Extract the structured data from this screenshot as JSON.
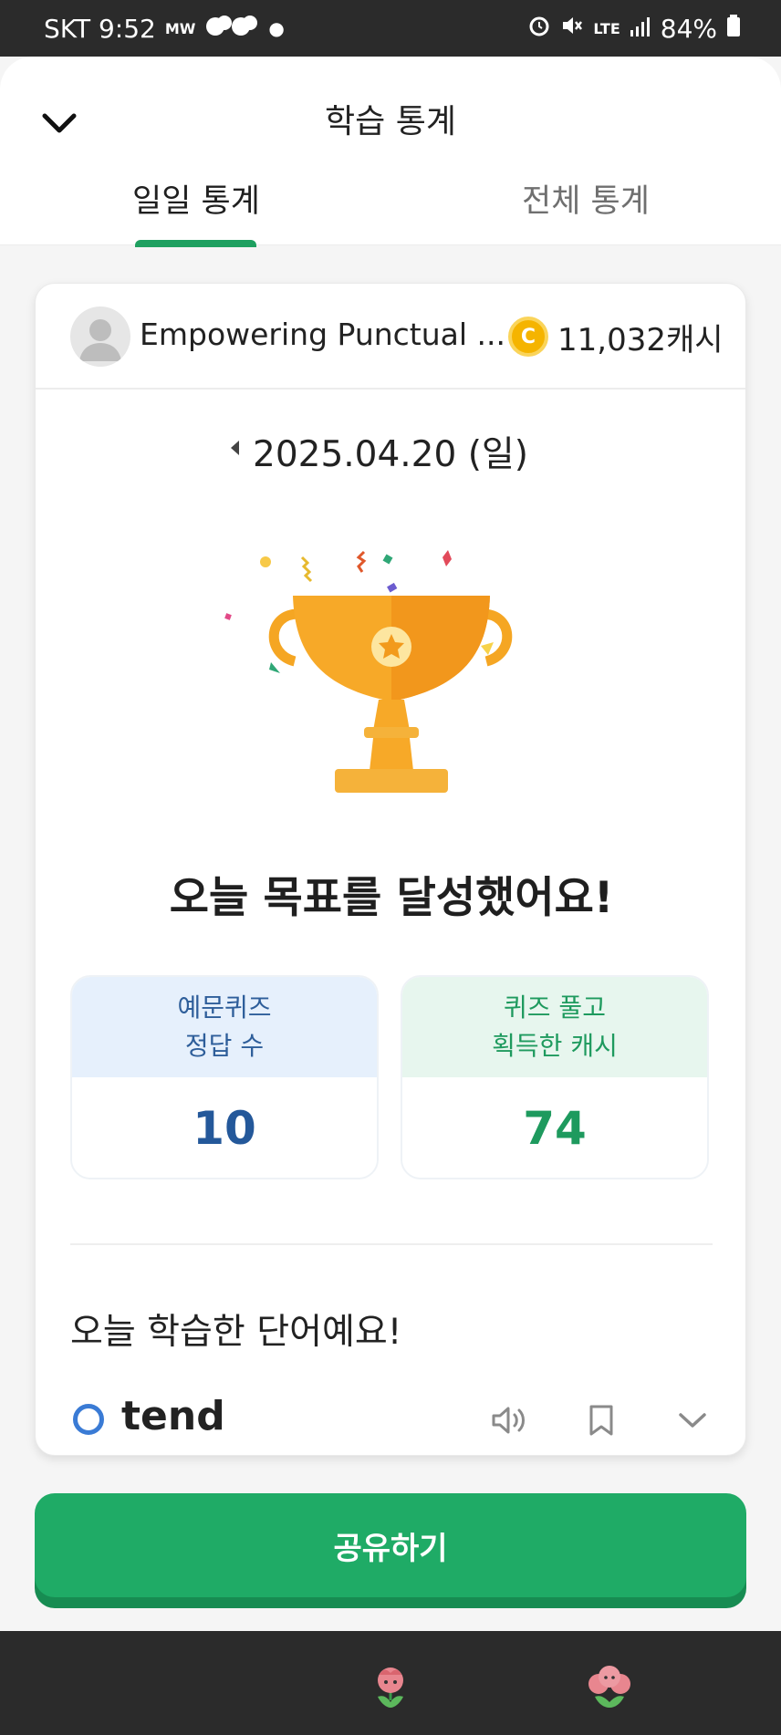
{
  "status_bar": {
    "carrier_time": "SKT 9:52",
    "mw": "MW",
    "network": "LTE",
    "battery": "84%"
  },
  "header": {
    "title": "학습 통계",
    "tabs": [
      {
        "label": "일일 통계",
        "active": true
      },
      {
        "label": "전체 통계",
        "active": false
      }
    ]
  },
  "profile": {
    "name": "Empowering Punctual ...",
    "cash": "11,032캐시"
  },
  "date": {
    "label": "2025.04.20 (일)"
  },
  "achievement": {
    "message": "오늘 목표를 달성했어요!"
  },
  "stats": [
    {
      "label_line1": "예문퀴즈",
      "label_line2": "정답 수",
      "value": "10"
    },
    {
      "label_line1": "퀴즈 풀고",
      "label_line2": "획득한 캐시",
      "value": "74"
    }
  ],
  "words": {
    "title": "오늘 학습한 단어예요!",
    "items": [
      {
        "word": "tend"
      }
    ]
  },
  "share_button": "공유하기",
  "colors": {
    "accent_green": "#1fab66",
    "stat_blue": "#24589a",
    "trophy_gold": "#f5a623"
  }
}
